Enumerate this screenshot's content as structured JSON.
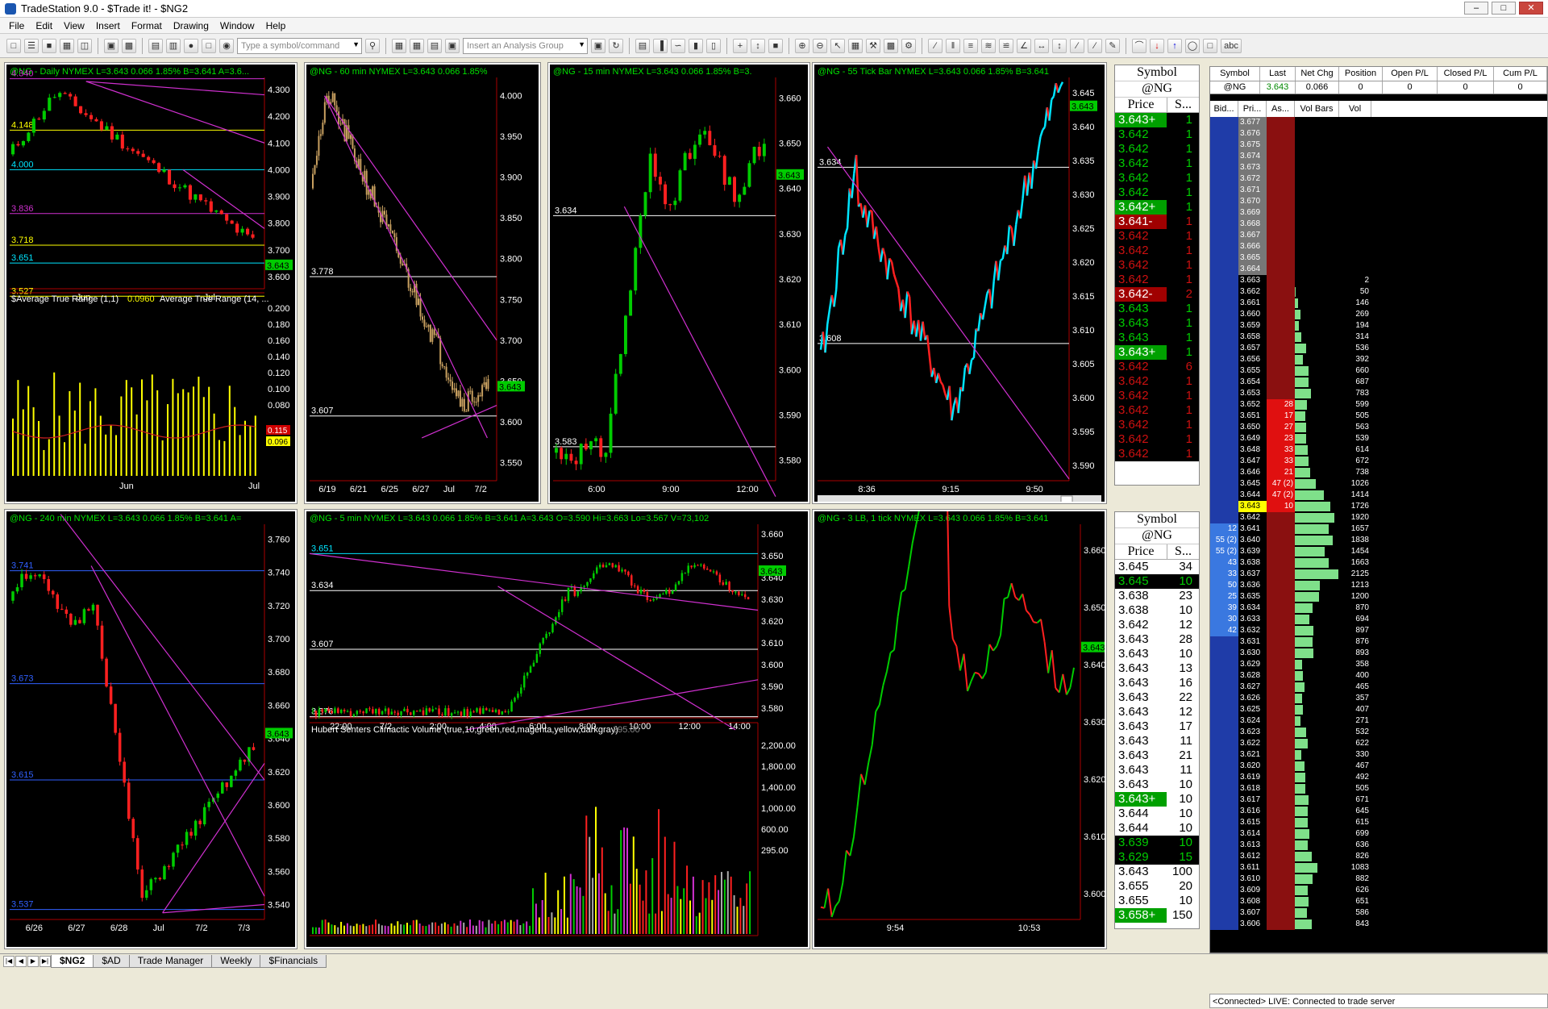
{
  "app": {
    "title": "TradeStation 9.0 - $Trade it! - $NG2"
  },
  "menu": [
    "File",
    "Edit",
    "View",
    "Insert",
    "Format",
    "Drawing",
    "Window",
    "Help"
  ],
  "toolbar": {
    "symbol_placeholder": "Type a symbol/command",
    "analysis_placeholder": "Insert an Analysis Group"
  },
  "charts": {
    "daily": {
      "header": "@NG - Daily  NYMEX  L=3.643  0.066   1.85%    B=3.641  A=3.6...",
      "yticks": [
        "4.300",
        "4.200",
        "4.100",
        "4.000",
        "3.900",
        "3.800",
        "3.700",
        "3.600"
      ],
      "xticks": [
        "Jun",
        "Jul"
      ],
      "levels": [
        "4.340",
        "4.148",
        "4.000",
        "3.836",
        "3.718",
        "3.651",
        "3.527"
      ],
      "last": "3.643",
      "indicator": "$Average True Range (1,1)",
      "ind_val": "0.0960",
      "indicator2": "Average True Range (14, ...",
      "ind_ticks": [
        "0.200",
        "0.180",
        "0.160",
        "0.140",
        "0.120",
        "0.100",
        "0.080"
      ],
      "ind_tags": [
        "0.115",
        "0.096"
      ]
    },
    "m60": {
      "header": "@NG - 60 min  NYMEX  L=3.643  0.066   1.85%",
      "yticks": [
        "4.000",
        "3.950",
        "3.900",
        "3.850",
        "3.800",
        "3.750",
        "3.700",
        "3.650",
        "3.600",
        "3.550"
      ],
      "xticks": [
        "6/19",
        "6/21",
        "6/25",
        "6/27",
        "Jul",
        "7/2"
      ],
      "levels": [
        "3.778",
        "3.607"
      ],
      "last": "3.643"
    },
    "m15": {
      "header": "@NG - 15 min  NYMEX  L=3.643  0.066   1.85%    B=3.",
      "yticks": [
        "3.660",
        "3.650",
        "3.640",
        "3.630",
        "3.620",
        "3.610",
        "3.600",
        "3.590",
        "3.580"
      ],
      "xticks": [
        "6:00",
        "9:00",
        "12:00"
      ],
      "levels": [
        "3.634",
        "3.583"
      ],
      "last": "3.643"
    },
    "tick55": {
      "header": "@NG - 55 Tick Bar  NYMEX  L=3.643  0.066   1.85%    B=3.641",
      "yticks": [
        "3.645",
        "3.640",
        "3.635",
        "3.630",
        "3.625",
        "3.620",
        "3.615",
        "3.610",
        "3.605",
        "3.600",
        "3.595",
        "3.590"
      ],
      "xticks": [
        "8:36",
        "9:15",
        "9:50"
      ],
      "levels": [
        "3.634",
        "3.608"
      ],
      "last": "3.643"
    },
    "m240": {
      "header": "@NG - 240 min  NYMEX  L=3.643  0.066   1.85%    B=3.641  A=",
      "yticks": [
        "3.760",
        "3.740",
        "3.720",
        "3.700",
        "3.680",
        "3.660",
        "3.640",
        "3.620",
        "3.600",
        "3.580",
        "3.560",
        "3.540"
      ],
      "xticks": [
        "6/26",
        "6/27",
        "6/28",
        "Jul",
        "7/2",
        "7/3"
      ],
      "levels": [
        "3.741",
        "3.673",
        "3.615",
        "3.537"
      ],
      "last": "3.643"
    },
    "m5": {
      "header": "@NG - 5 min  NYMEX  L=3.643  0.066   1.85%    B=3.641  A=3.643  O=3.590  Hi=3.663  Lo=3.567  V=73,102",
      "yticks": [
        "3.660",
        "3.650",
        "3.640",
        "3.630",
        "3.620",
        "3.610",
        "3.600",
        "3.590",
        "3.580"
      ],
      "xticks": [
        "22:00",
        "7/2",
        "2:00",
        "4:00",
        "6:00",
        "8:00",
        "10:00",
        "12:00",
        "14:00"
      ],
      "levels": [
        "3.651",
        "3.634",
        "3.607",
        "3.576"
      ],
      "last": "3.643",
      "indicator": "Hubert Senters Climactic Volume (true,10,green,red,magenta,yellow,darkgray)",
      "ind_peak": "295.00",
      "vol_ticks": [
        "2,200.00",
        "1,800.00",
        "1,400.00",
        "1,000.00",
        "600.00",
        "295.00"
      ]
    },
    "lb3": {
      "header": "@NG - 3 LB, 1 tick  NYMEX  L=3.643  0.066   1.85%    B=3.641",
      "yticks": [
        "3.660",
        "3.650",
        "3.640",
        "3.630",
        "3.620",
        "3.610",
        "3.600"
      ],
      "xticks": [
        "9:54",
        "10:53"
      ],
      "last": "3.643"
    }
  },
  "dom1": {
    "symbol_label": "Symbol",
    "symbol": "@NG",
    "col_price": "Price",
    "col_size": "S...",
    "rows": [
      [
        "3.643+",
        "1",
        "g"
      ],
      [
        "3.642",
        "1",
        "g"
      ],
      [
        "3.642",
        "1",
        "g"
      ],
      [
        "3.642",
        "1",
        "g"
      ],
      [
        "3.642",
        "1",
        "g"
      ],
      [
        "3.642",
        "1",
        "g"
      ],
      [
        "3.642+",
        "1",
        "g"
      ],
      [
        "3.641-",
        "1",
        "r"
      ],
      [
        "3.642",
        "1",
        "r"
      ],
      [
        "3.642",
        "1",
        "r"
      ],
      [
        "3.642",
        "1",
        "r"
      ],
      [
        "3.642",
        "1",
        "r"
      ],
      [
        "3.642-",
        "2",
        "r"
      ],
      [
        "3.643",
        "1",
        "g"
      ],
      [
        "3.643",
        "1",
        "g"
      ],
      [
        "3.643",
        "1",
        "g"
      ],
      [
        "3.643+",
        "1",
        "g"
      ],
      [
        "3.642",
        "6",
        "r"
      ],
      [
        "3.642",
        "1",
        "r"
      ],
      [
        "3.642",
        "1",
        "r"
      ],
      [
        "3.642",
        "1",
        "r"
      ],
      [
        "3.642",
        "1",
        "r"
      ],
      [
        "3.642",
        "1",
        "r"
      ],
      [
        "3.642",
        "1",
        "r"
      ]
    ]
  },
  "dom2": {
    "symbol_label": "Symbol",
    "symbol": "@NG",
    "col_price": "Price",
    "col_size": "S...",
    "rows": [
      [
        "3.645",
        "34"
      ],
      [
        "3.645",
        "10"
      ],
      [
        "3.638",
        "23"
      ],
      [
        "3.638",
        "10"
      ],
      [
        "3.642",
        "12"
      ],
      [
        "3.643",
        "28"
      ],
      [
        "3.643",
        "10"
      ],
      [
        "3.643",
        "13"
      ],
      [
        "3.643",
        "16"
      ],
      [
        "3.643",
        "22"
      ],
      [
        "3.643",
        "12"
      ],
      [
        "3.643",
        "17"
      ],
      [
        "3.643",
        "11"
      ],
      [
        "3.643",
        "21"
      ],
      [
        "3.643",
        "11"
      ],
      [
        "3.643",
        "10"
      ],
      [
        "3.643+",
        "10"
      ],
      [
        "3.644",
        "10"
      ],
      [
        "3.644",
        "10"
      ],
      [
        "3.639",
        "10"
      ],
      [
        "3.629",
        "15"
      ],
      [
        "3.643",
        "100"
      ],
      [
        "3.655",
        "20"
      ],
      [
        "3.655",
        "10"
      ],
      [
        "3.658+",
        "150"
      ]
    ]
  },
  "market": {
    "headers": [
      "Symbol",
      "Last",
      "Net Chg",
      "Position",
      "Open P/L",
      "Closed P/L",
      "Cum P/L"
    ],
    "row": [
      "@NG",
      "3.643",
      "0.066",
      "0",
      "0",
      "0",
      "0"
    ]
  },
  "ladder": {
    "headers": [
      "Bid...",
      "Pri...",
      "As...",
      "Vol Bars",
      "Vol"
    ],
    "rows": [
      [
        "",
        "3.677",
        "",
        "",
        ""
      ],
      [
        "",
        "3.676",
        "",
        "",
        ""
      ],
      [
        "",
        "3.675",
        "",
        "",
        ""
      ],
      [
        "",
        "3.674",
        "",
        "",
        ""
      ],
      [
        "",
        "3.673",
        "",
        "",
        ""
      ],
      [
        "",
        "3.672",
        "",
        "",
        ""
      ],
      [
        "",
        "3.671",
        "",
        "",
        ""
      ],
      [
        "",
        "3.670",
        "",
        "",
        ""
      ],
      [
        "",
        "3.669",
        "",
        "",
        ""
      ],
      [
        "",
        "3.668",
        "",
        "",
        ""
      ],
      [
        "",
        "3.667",
        "",
        "",
        ""
      ],
      [
        "",
        "3.666",
        "",
        "",
        ""
      ],
      [
        "",
        "3.665",
        "",
        "",
        ""
      ],
      [
        "",
        "3.664",
        "",
        "",
        ""
      ],
      [
        "",
        "3.663",
        "",
        "",
        "2"
      ],
      [
        "",
        "3.662",
        "",
        "",
        "50"
      ],
      [
        "",
        "3.661",
        "",
        "",
        "146"
      ],
      [
        "",
        "3.660",
        "",
        "",
        "269"
      ],
      [
        "",
        "3.659",
        "",
        "",
        "194"
      ],
      [
        "",
        "3.658",
        "",
        "",
        "314"
      ],
      [
        "",
        "3.657",
        "",
        "",
        "536"
      ],
      [
        "",
        "3.656",
        "",
        "",
        "392"
      ],
      [
        "",
        "3.655",
        "",
        "",
        "660"
      ],
      [
        "",
        "3.654",
        "",
        "",
        "687"
      ],
      [
        "",
        "3.653",
        "",
        "",
        "783"
      ],
      [
        "",
        "3.652",
        "28",
        "",
        "599"
      ],
      [
        "",
        "3.651",
        "17",
        "",
        "505"
      ],
      [
        "",
        "3.650",
        "27",
        "",
        "563"
      ],
      [
        "",
        "3.649",
        "23",
        "",
        "539"
      ],
      [
        "",
        "3.648",
        "33",
        "",
        "614"
      ],
      [
        "",
        "3.647",
        "33",
        "",
        "672"
      ],
      [
        "",
        "3.646",
        "21",
        "",
        "738"
      ],
      [
        "",
        "3.645",
        "47 (2)",
        "",
        "1026"
      ],
      [
        "",
        "3.644",
        "47 (2)",
        "",
        "1414"
      ],
      [
        "",
        "3.643",
        "10",
        "",
        "1726"
      ],
      [
        "",
        "3.642",
        "",
        "",
        "1920"
      ],
      [
        "12",
        "3.641",
        "",
        "",
        "1657"
      ],
      [
        "55 (2)",
        "3.640",
        "",
        "",
        "1838"
      ],
      [
        "55 (2)",
        "3.639",
        "",
        "",
        "1454"
      ],
      [
        "43",
        "3.638",
        "",
        "",
        "1663"
      ],
      [
        "33",
        "3.637",
        "",
        "",
        "2125"
      ],
      [
        "50",
        "3.636",
        "",
        "",
        "1213"
      ],
      [
        "25",
        "3.635",
        "",
        "",
        "1200"
      ],
      [
        "39",
        "3.634",
        "",
        "",
        "870"
      ],
      [
        "30",
        "3.633",
        "",
        "",
        "694"
      ],
      [
        "42",
        "3.632",
        "",
        "",
        "897"
      ],
      [
        "",
        "3.631",
        "",
        "",
        "876"
      ],
      [
        "",
        "3.630",
        "",
        "",
        "893"
      ],
      [
        "",
        "3.629",
        "",
        "",
        "358"
      ],
      [
        "",
        "3.628",
        "",
        "",
        "400"
      ],
      [
        "",
        "3.627",
        "",
        "",
        "465"
      ],
      [
        "",
        "3.626",
        "",
        "",
        "357"
      ],
      [
        "",
        "3.625",
        "",
        "",
        "407"
      ],
      [
        "",
        "3.624",
        "",
        "",
        "271"
      ],
      [
        "",
        "3.623",
        "",
        "",
        "532"
      ],
      [
        "",
        "3.622",
        "",
        "",
        "622"
      ],
      [
        "",
        "3.621",
        "",
        "",
        "330"
      ],
      [
        "",
        "3.620",
        "",
        "",
        "467"
      ],
      [
        "",
        "3.619",
        "",
        "",
        "492"
      ],
      [
        "",
        "3.618",
        "",
        "",
        "505"
      ],
      [
        "",
        "3.617",
        "",
        "",
        "671"
      ],
      [
        "",
        "3.616",
        "",
        "",
        "645"
      ],
      [
        "",
        "3.615",
        "",
        "",
        "615"
      ],
      [
        "",
        "3.614",
        "",
        "",
        "699"
      ],
      [
        "",
        "3.613",
        "",
        "",
        "636"
      ],
      [
        "",
        "3.612",
        "",
        "",
        "826"
      ],
      [
        "",
        "3.611",
        "",
        "",
        "1083"
      ],
      [
        "",
        "3.610",
        "",
        "",
        "882"
      ],
      [
        "",
        "3.609",
        "",
        "",
        "626"
      ],
      [
        "",
        "3.608",
        "",
        "",
        "651"
      ],
      [
        "",
        "3.607",
        "",
        "",
        "586"
      ],
      [
        "",
        "3.606",
        "",
        "",
        "843"
      ]
    ]
  },
  "status": "<Connected> LIVE:  Connected to trade server",
  "tabs": [
    "$NG2",
    "$AD",
    "Trade Manager",
    "Weekly",
    "$Financials"
  ],
  "colors": {
    "up": "#00cc00",
    "down": "#ff2020",
    "cyan": "#00e5ff",
    "magenta": "#d030d0",
    "yellow": "#ffff00"
  }
}
